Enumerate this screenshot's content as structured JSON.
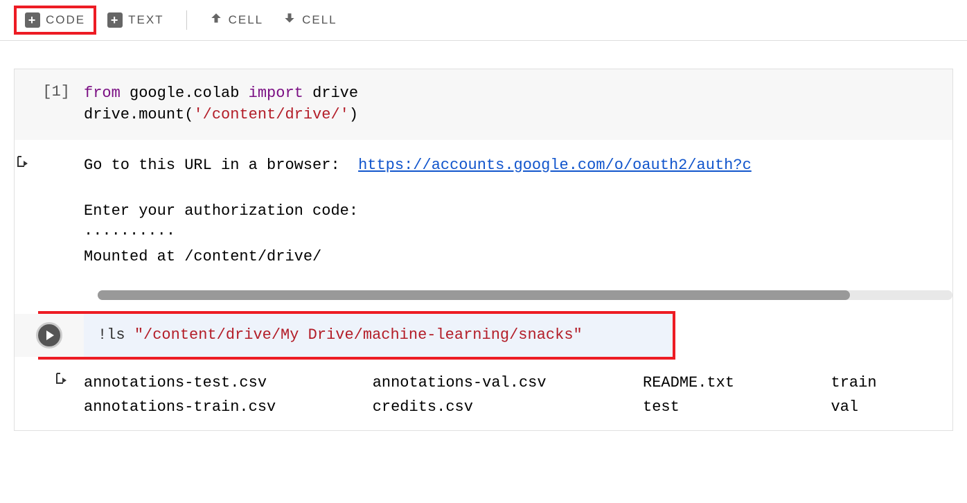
{
  "toolbar": {
    "code_label": "CODE",
    "text_label": "TEXT",
    "cell_up_label": "CELL",
    "cell_down_label": "CELL"
  },
  "cell1": {
    "prompt": "[1]",
    "code_kw_from": "from",
    "code_mod": " google.colab ",
    "code_kw_import": "import",
    "code_name": " drive",
    "code_line2_pre": "drive.mount(",
    "code_line2_str": "'/content/drive/'",
    "code_line2_post": ")",
    "output_line1_pre": "Go to this URL in a browser:  ",
    "output_link": "https://accounts.google.com/o/oauth2/auth?c",
    "output_line3": "Enter your authorization code:",
    "output_dots": "··········",
    "output_mounted": "Mounted at /content/drive/"
  },
  "cell2": {
    "code_pre": "!ls ",
    "code_str": "\"/content/drive/My Drive/machine-learning/snacks\"",
    "output": {
      "col1_r1": "annotations-test.csv",
      "col1_r2": "annotations-train.csv",
      "col2_r1": "annotations-val.csv",
      "col2_r2": "credits.csv",
      "col3_r1": "README.txt",
      "col3_r2": "test",
      "col4_r1": "train",
      "col4_r2": "val"
    }
  }
}
